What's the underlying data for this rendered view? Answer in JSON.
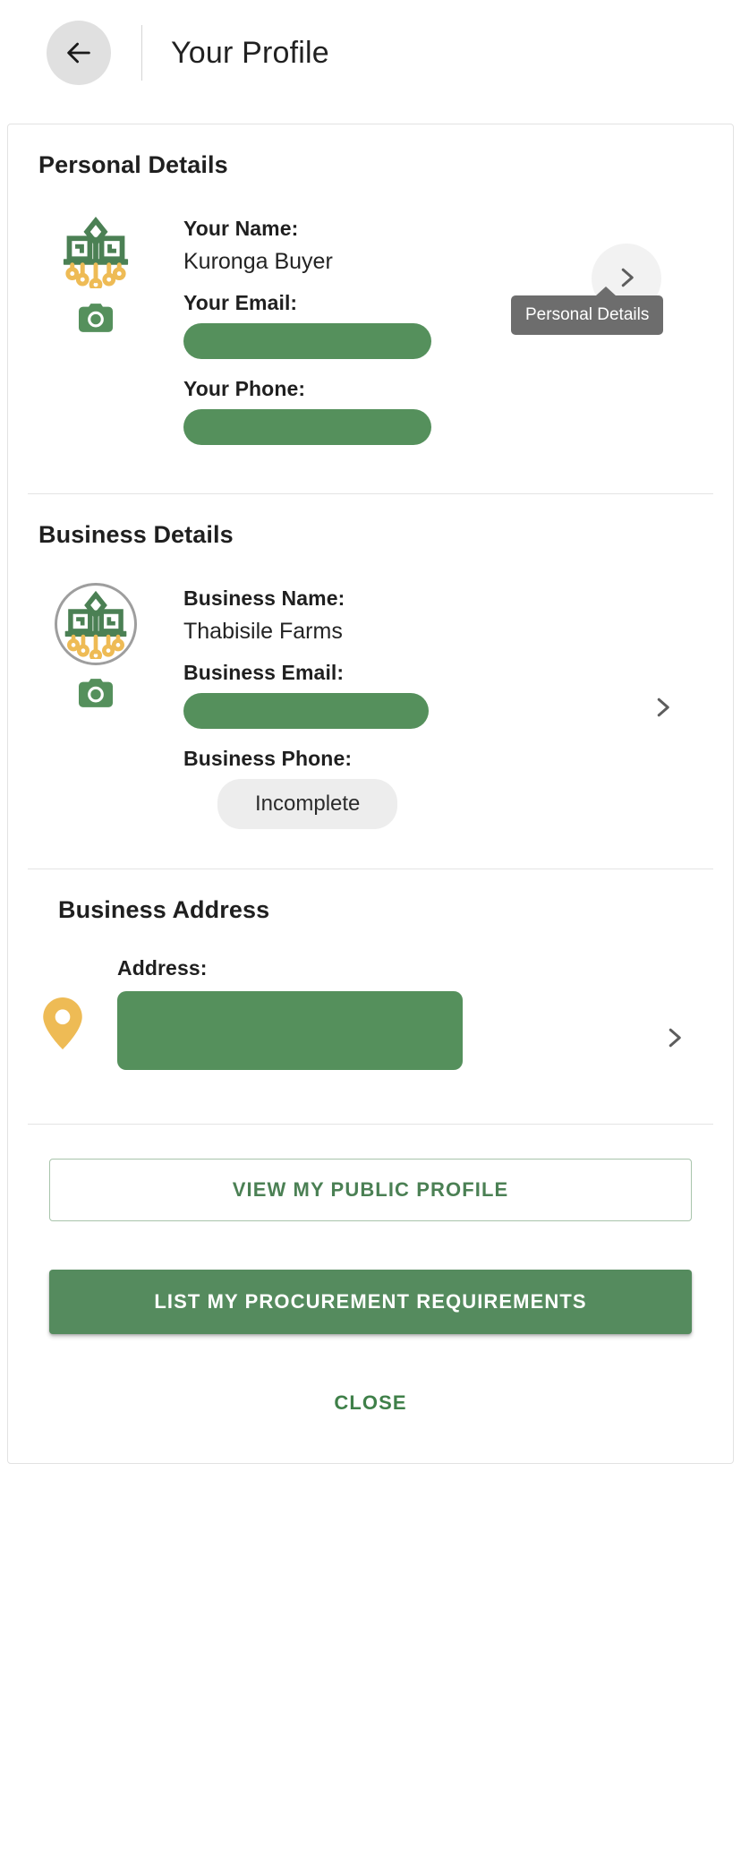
{
  "header": {
    "back_icon": "arrow-left-icon",
    "title": "Your Profile"
  },
  "colors": {
    "brand_green": "#55905c",
    "brand_green_dark": "#4b8054",
    "accent_amber": "#eebb55",
    "tooltip_bg": "#6d6d6d",
    "pill_bg": "#ededed",
    "header_circle": "#e0e0e0"
  },
  "sections": [
    {
      "id": "personal-details",
      "title": "Personal Details",
      "logo_icon": "plant-roots-logo-icon",
      "camera_icon": "camera-icon",
      "chevron_icon": "chevron-right-icon",
      "tooltip": "Personal Details",
      "fields": [
        {
          "label": "Your Name:",
          "value": "Kuronga Buyer",
          "type": "text"
        },
        {
          "label": "Your Email:",
          "value": "",
          "type": "redacted"
        },
        {
          "label": "Your Phone:",
          "value": "",
          "type": "redacted"
        }
      ]
    },
    {
      "id": "business-details",
      "title": "Business Details",
      "logo_icon": "plant-roots-logo-circled-icon",
      "camera_icon": "camera-icon",
      "chevron_icon": "chevron-right-icon",
      "fields": [
        {
          "label": "Business Name:",
          "value": "Thabisile Farms",
          "type": "text"
        },
        {
          "label": "Business Email:",
          "value": "",
          "type": "redacted"
        },
        {
          "label": "Business Phone:",
          "value": "Incomplete",
          "type": "pill"
        }
      ]
    },
    {
      "id": "business-address",
      "title": "Business Address",
      "pin_icon": "map-pin-icon",
      "chevron_icon": "chevron-right-icon",
      "fields": [
        {
          "label": "Address:",
          "value": "",
          "type": "redacted"
        }
      ]
    }
  ],
  "footer": {
    "view_profile_label": "VIEW MY PUBLIC PROFILE",
    "list_requirements_label": "LIST MY PROCUREMENT REQUIREMENTS",
    "close_label": "CLOSE"
  }
}
